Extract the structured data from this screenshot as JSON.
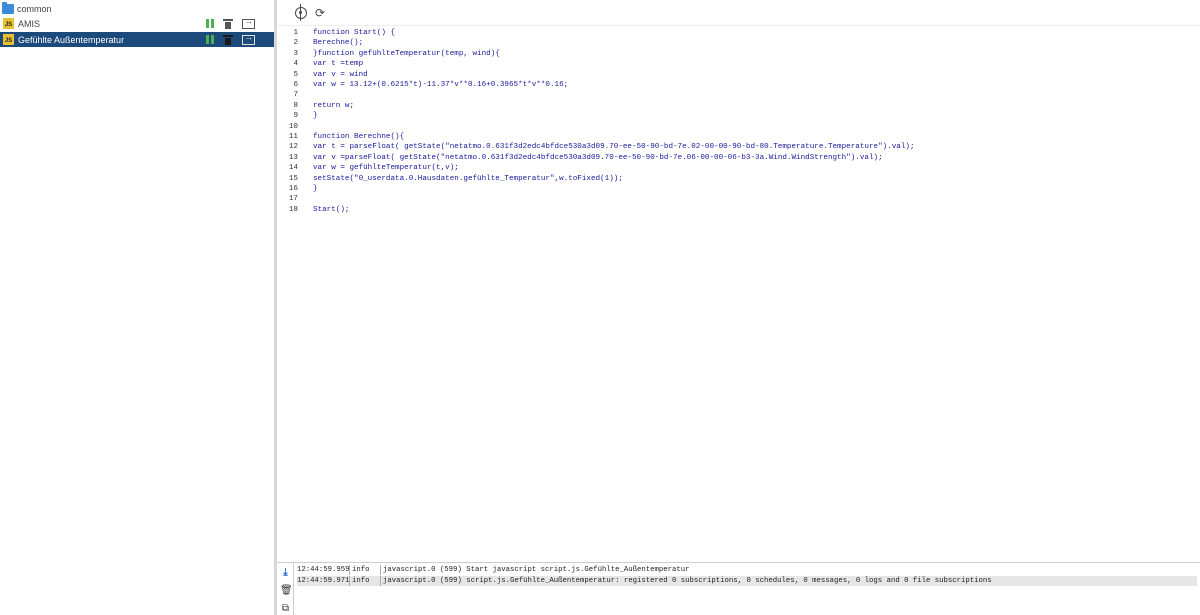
{
  "sidebar": {
    "folder": {
      "label": "common",
      "icon": "folder-icon"
    },
    "scripts": [
      {
        "label": "AMIS",
        "badge": "JS",
        "selected": false
      },
      {
        "label": "Gefühlte Außentemperatur",
        "badge": "JS",
        "selected": true
      }
    ],
    "actions": {
      "pause_icon": "pause-icon",
      "delete_icon": "trash-icon",
      "export_icon": "export-icon"
    }
  },
  "toolbar": {
    "locate_icon": "crosshair-icon",
    "refresh_icon": "refresh-icon",
    "refresh_glyph": "⟳"
  },
  "editor": {
    "line_numbers": [
      "1",
      "2",
      "3",
      "4",
      "5",
      "6",
      "7",
      "8",
      "9",
      "10",
      "11",
      "12",
      "13",
      "14",
      "15",
      "16",
      "17",
      "18"
    ],
    "lines": [
      "function Start() {",
      "Berechne();",
      "}function gefühlteTemperatur(temp, wind){",
      "var t =temp",
      "var v = wind",
      "var w = 13.12+(0.6215*t)-11.37*v**0.16+0.3965*t*v**0.16;",
      "",
      "return w;",
      "}",
      "",
      "function Berechne(){",
      "var t = parseFloat( getState(\"netatmo.0.631f3d2edc4bfdce530a3d09.70-ee-50-90-bd-7e.02-00-00-90-bd-80.Temperature.Temperature\").val);",
      "var v =parseFloat( getState(\"netatmo.0.631f3d2edc4bfdce530a3d09.70-ee-50-90-bd-7e.06-00-00-06-b3-3a.Wind.WindStrength\").val);",
      "var w = gefühlteTemperatur(t,v);",
      "setState(\"0_userdata.0.Hausdaten.gefühlte_Temperatur\",w.toFixed(1));",
      "}",
      "",
      "Start();"
    ]
  },
  "log": {
    "download_glyph": "⤓",
    "clear_glyph": "🗑",
    "copy_glyph": "⧉",
    "rows": [
      {
        "time": "12:44:59.959",
        "level": "info",
        "message": "javascript.0 (599) Start javascript script.js.Gefühlte_Außentemperatur"
      },
      {
        "time": "12:44:59.971",
        "level": "info",
        "message": "javascript.0 (599) script.js.Gefühlte_Außentemperatur: registered 0 subscriptions, 0 schedules, 0 messages, 0 logs and 0 file subscriptions"
      }
    ]
  },
  "colors": {
    "selected_row": "#1c4a7a",
    "js_badge": "#e8c130",
    "pause": "#4caf50",
    "folder": "#3d8bd8",
    "code_keyword": "#1a1a9a"
  }
}
